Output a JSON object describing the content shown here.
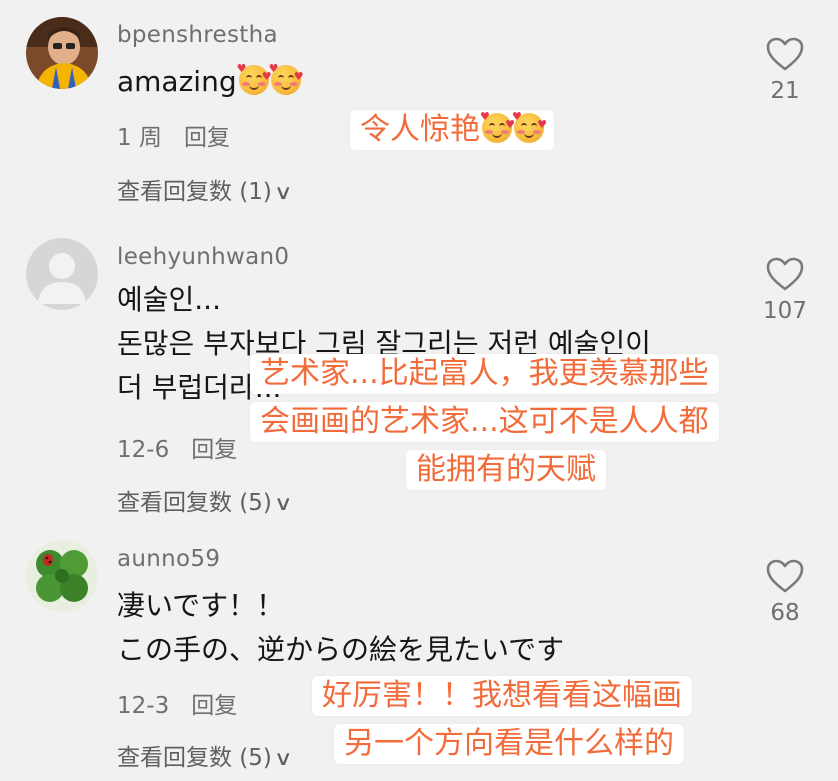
{
  "comments": [
    {
      "username": "bpenshrestha",
      "text": "amazing",
      "emoji_count": 2,
      "date": "1 周",
      "reply_label": "回复",
      "view_replies": "查看回复数 (1)",
      "likes": "21",
      "translation_lines": [
        "令人惊艳"
      ],
      "translation_emoji_count": 2
    },
    {
      "username": "leehyunhwan0",
      "text_lines": [
        "예술인...",
        "돈많은 부자보다 그림 잘그리는 저런 예술인이",
        "더 부럽더라..."
      ],
      "date": "12-6",
      "reply_label": "回复",
      "view_replies": "查看回复数 (5)",
      "likes": "107",
      "translation_lines": [
        "艺术家...比起富人，我更羡慕那些",
        "会画画的艺术家...这可不是人人都",
        "能拥有的天赋"
      ]
    },
    {
      "username": "aunno59",
      "text_lines": [
        "凄いです！！",
        "この手の、逆からの絵を見たいです"
      ],
      "date": "12-3",
      "reply_label": "回复",
      "view_replies": "查看回复数 (5)",
      "likes": "68",
      "translation_lines": [
        "好厉害！！我想看看这幅画",
        "另一个方向看是什么样的"
      ]
    }
  ],
  "icons": {
    "like": "heart-outline-icon",
    "expand": "chevron-down-icon",
    "emoji": "smiling-face-with-hearts-emoji"
  },
  "colors": {
    "background": "#f1f1f1",
    "translation_text": "#f26b3a",
    "secondary_text": "#6f6f6f"
  }
}
